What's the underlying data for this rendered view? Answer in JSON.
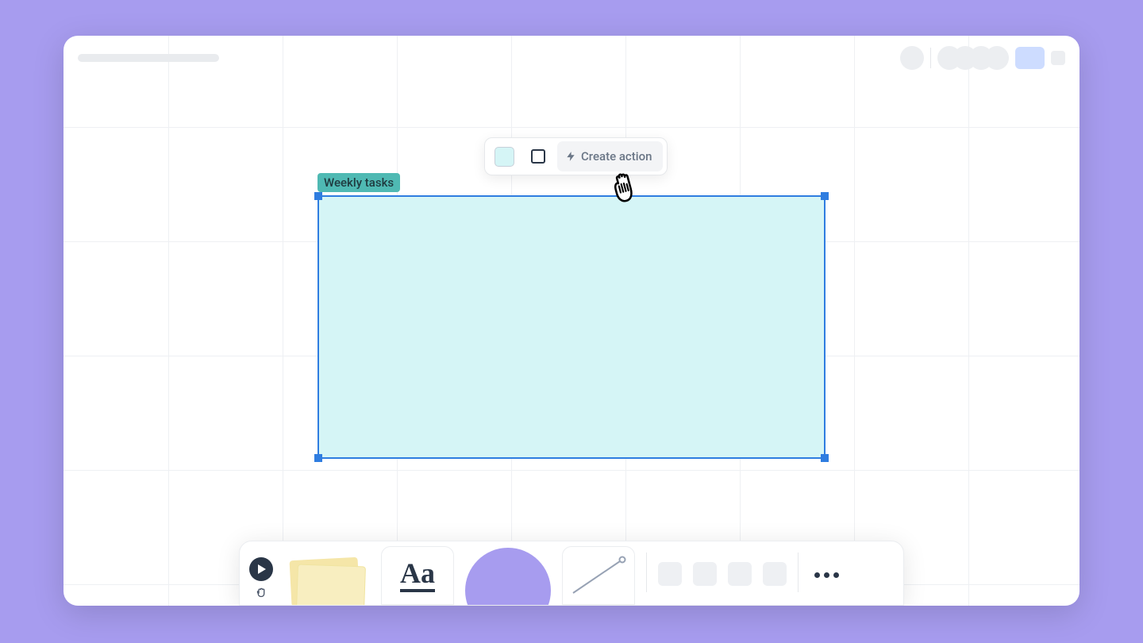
{
  "shape": {
    "label": "Weekly tasks"
  },
  "context_toolbar": {
    "create_action_label": "Create action"
  },
  "bottom_toolbar": {
    "text_tool_label": "Aa"
  },
  "icons": {
    "bolt": "bolt-icon",
    "pointer": "pointer-icon",
    "hand": "hand-icon",
    "more": "more-icon"
  },
  "colors": {
    "canvas_bg": "#a79cef",
    "shape_fill": "#d5f5f6",
    "selection": "#2f7de0",
    "label_bg": "#4fb9b3",
    "sticky": "#f5e6a8"
  }
}
